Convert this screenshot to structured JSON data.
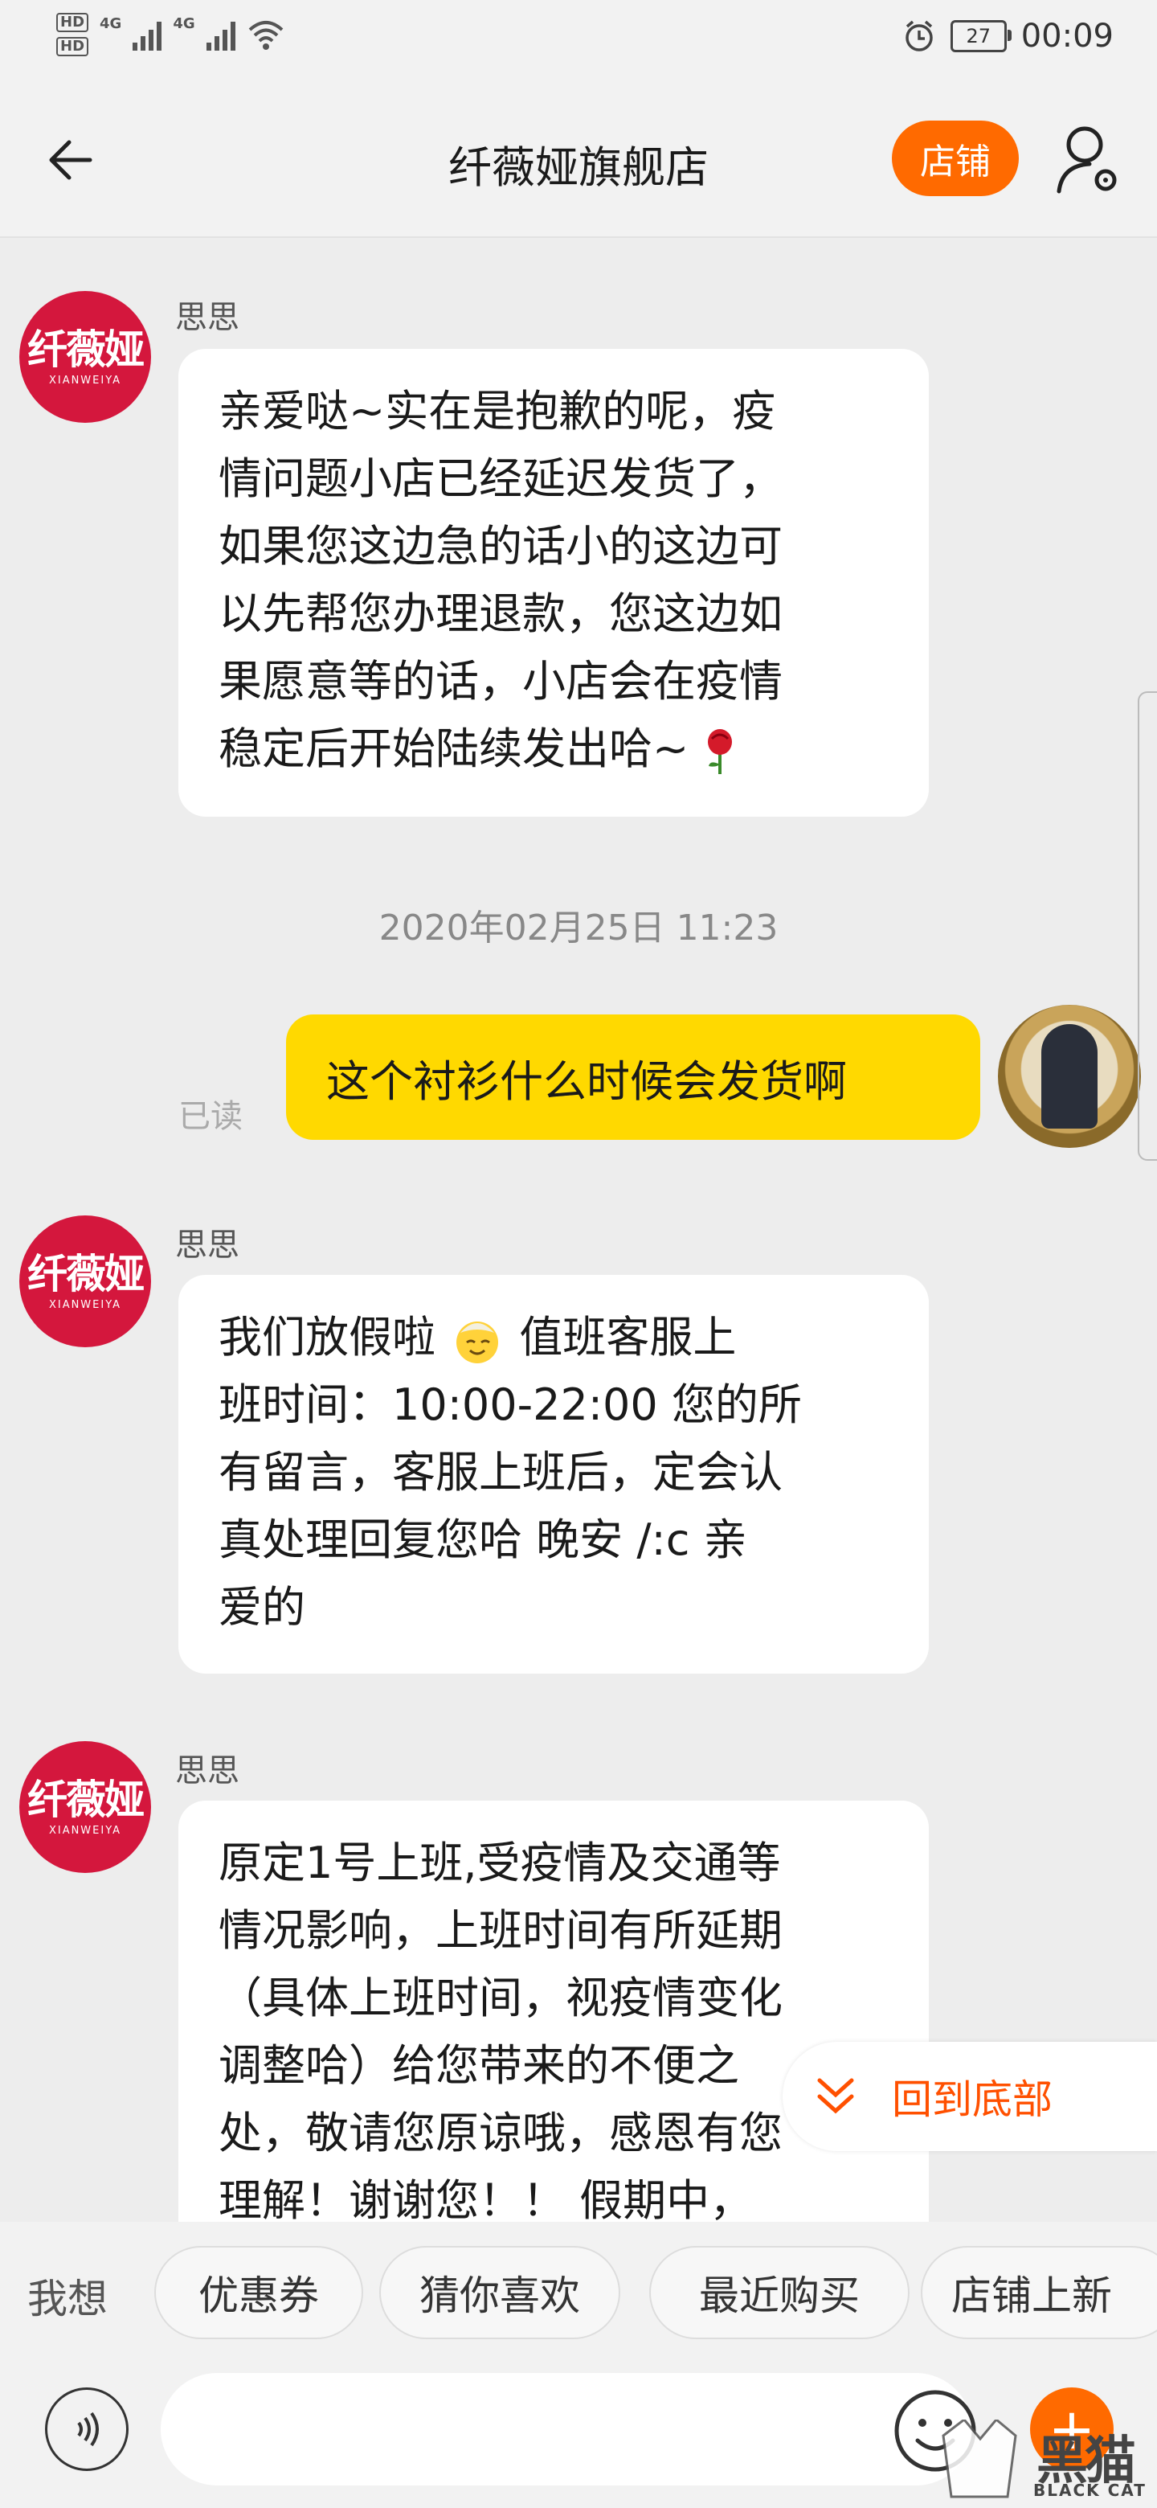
{
  "status_bar": {
    "left_tags": [
      "HD",
      "HD"
    ],
    "network": [
      "4G",
      "4G"
    ],
    "battery": "27",
    "time": "00:09"
  },
  "nav": {
    "title": "纤薇娅旗舰店",
    "store_button": "店铺"
  },
  "shop_avatar": {
    "name_cn": "纤薇娅",
    "name_en": "XIANWEIYA"
  },
  "messages": [
    {
      "sender": "思思",
      "lines": [
        "亲爱哒~实在是抱歉的呢，疫",
        "情问题小店已经延迟发货了，",
        "如果您这边急的话小的这边可",
        "以先帮您办理退款，您这边如",
        "果愿意等的话，小店会在疫情",
        "稳定后开始陆续发出哈~ "
      ],
      "emoji": "rose"
    },
    {
      "time": "2020年02月25日 11:23"
    },
    {
      "mine": "这个衬衫什么时候会发货啊",
      "read": "已读"
    },
    {
      "sender": "思思",
      "lines": [
        "我们放假啦 ",
        "班时间：10:00-22:00 您的所",
        "有留言，客服上班后，定会认",
        "真处理回复您哈  晚安  /:c  亲",
        "爱的"
      ],
      "line1_after": "  值班客服上",
      "emoji": "smile"
    },
    {
      "sender": "思思",
      "lines": [
        "原定1号上班,受疫情及交通等",
        "情况影响，上班时间有所延期",
        "（具体上班时间，视疫情变化",
        "调整哈）给您带来的不便之",
        "处，敬请您原谅哦，感恩有您",
        "理解！谢谢您！！ 假期中，"
      ]
    }
  ],
  "back_to_bottom": "回到底部",
  "quick": {
    "label": "我想",
    "chips": [
      "优惠券",
      "猜你喜欢",
      "最近购买",
      "店铺上新"
    ]
  },
  "input": {
    "placeholder": ""
  },
  "watermark": {
    "cn": "黑猫",
    "en": "BLACK CAT"
  }
}
